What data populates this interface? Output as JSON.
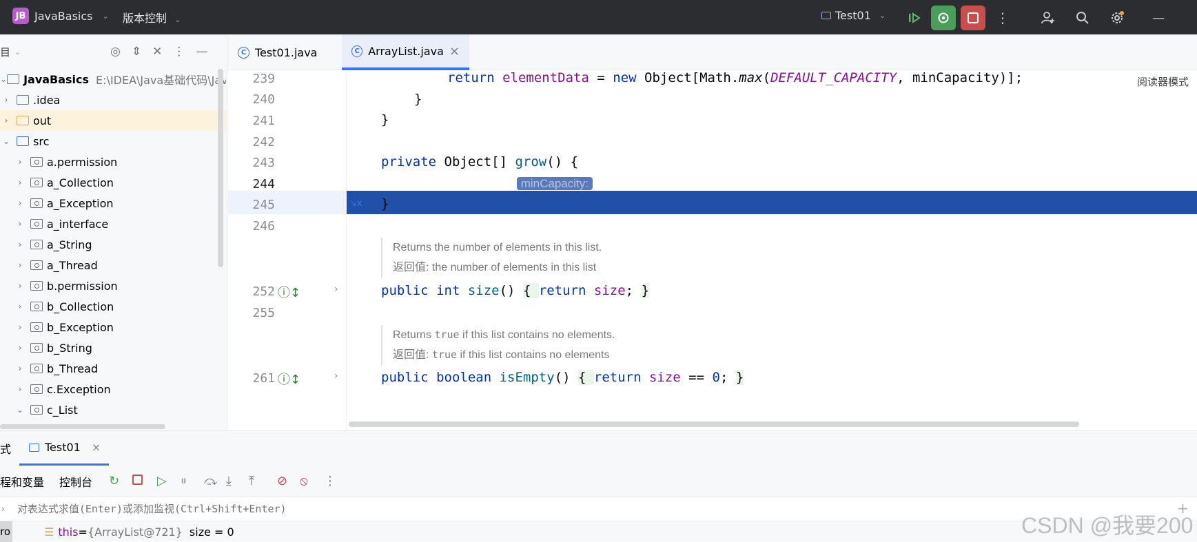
{
  "titlebar": {
    "project_badge": "JB",
    "project_name": "JavaBasics",
    "vcs_label": "版本控制",
    "run_config": "Test01"
  },
  "project_panel": {
    "title_fragment": "目",
    "root_name": "JavaBasics",
    "root_path": "E:\\IDEA\\Java基础代码\\Java",
    "items": [
      {
        "label": ".idea",
        "type": "folder"
      },
      {
        "label": "out",
        "type": "folder-excluded"
      },
      {
        "label": "src",
        "type": "folder-source"
      },
      {
        "label": "a.permission",
        "type": "package"
      },
      {
        "label": "a_Collection",
        "type": "package"
      },
      {
        "label": "a_Exception",
        "type": "package"
      },
      {
        "label": "a_interface",
        "type": "package"
      },
      {
        "label": "a_String",
        "type": "package"
      },
      {
        "label": "a_Thread",
        "type": "package"
      },
      {
        "label": "b.permission",
        "type": "package"
      },
      {
        "label": "b_Collection",
        "type": "package"
      },
      {
        "label": "b_Exception",
        "type": "package"
      },
      {
        "label": "b_String",
        "type": "package"
      },
      {
        "label": "b_Thread",
        "type": "package"
      },
      {
        "label": "c.Exception",
        "type": "package"
      },
      {
        "label": "c_List",
        "type": "package"
      }
    ]
  },
  "tabs": [
    {
      "label": "Test01.java",
      "active": false
    },
    {
      "label": "ArrayList.java",
      "active": true,
      "close": "×"
    }
  ],
  "editor": {
    "reader_mode": "阅读器模式",
    "line_numbers": [
      "239",
      "240",
      "241",
      "242",
      "243",
      "244",
      "245",
      "246",
      "252",
      "255",
      "261"
    ],
    "hint_label": "minCapacity:",
    "doc1_line1": "Returns the number of elements in this list.",
    "doc1_line2": "返回值: the number of elements in this list",
    "doc2_line1_pre": "Returns ",
    "doc2_line1_code": "true",
    "doc2_line1_post": " if this list contains no elements.",
    "doc2_line2_pre": "返回值: ",
    "doc2_line2_code": "true",
    "doc2_line2_post": " if this list contains no elements"
  },
  "debug": {
    "fragment_left": "式",
    "session_tab": "Test01",
    "session_close": "×",
    "tab_threads": "程和变量",
    "tab_console": "控制台",
    "expr_placeholder": "对表达式求值(Enter)或添加监视(Ctrl+Shift+Enter)",
    "var_prefix": "ro",
    "var_name": "this",
    "var_eq": " = ",
    "var_value": "{ArrayList@721}",
    "var_extra": "size = 0",
    "add_icon": "+"
  },
  "watermark": "CSDN @我要200"
}
